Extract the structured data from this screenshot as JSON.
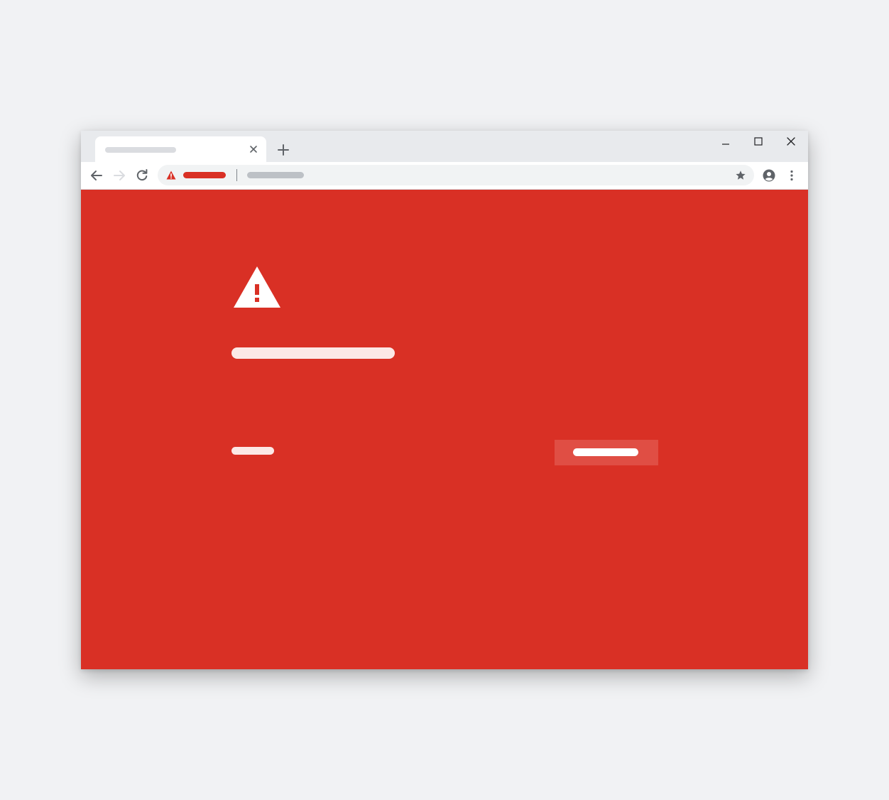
{
  "colors": {
    "desktop_background": "#f1f2f4",
    "tabstrip": "#e8eaed",
    "tab": "#ffffff",
    "toolbar": "#ffffff",
    "omnibox": "#f1f3f4",
    "danger_red": "#d93025",
    "button_red": "#e04e44",
    "heading_placeholder": "#fce8e6",
    "paragraph_placeholder": "#f0a19b",
    "icon_gray": "#5f6368",
    "icon_disabled": "#dadce0"
  },
  "browser": {
    "tab": {
      "title": "",
      "close_icon": "close-icon"
    },
    "new_tab_icon": "plus-icon",
    "window_controls": [
      "minimize-icon",
      "maximize-icon",
      "close-icon"
    ],
    "toolbar": {
      "back_icon": "arrow-left-icon",
      "forward_icon": "arrow-right-icon",
      "forward_enabled": false,
      "reload_icon": "reload-icon",
      "omnibox": {
        "security_icon": "warning-triangle-icon",
        "security_label": "",
        "url": ""
      },
      "bookmark_icon": "star-icon",
      "account_icon": "account-circle-icon",
      "menu_icon": "more-vertical-icon"
    }
  },
  "interstitial": {
    "icon": "warning-triangle-icon",
    "heading": "",
    "paragraph": "",
    "details_link": "",
    "primary_button": ""
  }
}
